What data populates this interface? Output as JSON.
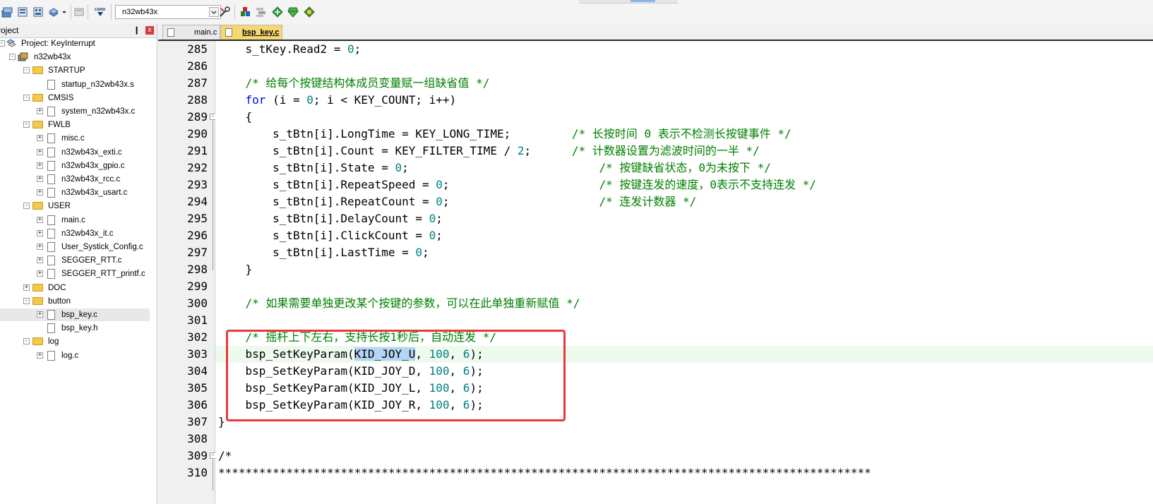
{
  "toolbar": {
    "target": "n32wb43x",
    "load_label": "LOAD",
    "icons": [
      "translate-icon",
      "rebuild-icon",
      "batch-build-icon",
      "stop-build-icon",
      "load-icon",
      "target-options-icon",
      "manage-components-icon",
      "select-pack-icon",
      "pack-installer-icon",
      "event-recorder-icon"
    ]
  },
  "project_panel": {
    "title": "roject",
    "pin": "❙",
    "close": "x",
    "tree": [
      {
        "label": "Project: KeyInterrupt",
        "type": "project",
        "level": 0,
        "expander": "-"
      },
      {
        "label": "n32wb43x",
        "type": "target",
        "level": 1,
        "expander": "-"
      },
      {
        "label": "STARTUP",
        "type": "folder",
        "level": 2,
        "expander": "-"
      },
      {
        "label": "startup_n32wb43x.s",
        "type": "file",
        "level": 3,
        "expander": ""
      },
      {
        "label": "CMSIS",
        "type": "folder",
        "level": 2,
        "expander": "-"
      },
      {
        "label": "system_n32wb43x.c",
        "type": "file",
        "level": 3,
        "expander": "+"
      },
      {
        "label": "FWLB",
        "type": "folder",
        "level": 2,
        "expander": "-"
      },
      {
        "label": "misc.c",
        "type": "file",
        "level": 3,
        "expander": "+"
      },
      {
        "label": "n32wb43x_exti.c",
        "type": "file",
        "level": 3,
        "expander": "+"
      },
      {
        "label": "n32wb43x_gpio.c",
        "type": "file",
        "level": 3,
        "expander": "+"
      },
      {
        "label": "n32wb43x_rcc.c",
        "type": "file",
        "level": 3,
        "expander": "+"
      },
      {
        "label": "n32wb43x_usart.c",
        "type": "file",
        "level": 3,
        "expander": "+"
      },
      {
        "label": "USER",
        "type": "folder",
        "level": 2,
        "expander": "-"
      },
      {
        "label": "main.c",
        "type": "file",
        "level": 3,
        "expander": "+"
      },
      {
        "label": "n32wb43x_it.c",
        "type": "file",
        "level": 3,
        "expander": "+"
      },
      {
        "label": "User_Systick_Config.c",
        "type": "file",
        "level": 3,
        "expander": "+"
      },
      {
        "label": "SEGGER_RTT.c",
        "type": "file",
        "level": 3,
        "expander": "+"
      },
      {
        "label": "SEGGER_RTT_printf.c",
        "type": "file",
        "level": 3,
        "expander": "+"
      },
      {
        "label": "DOC",
        "type": "folder",
        "level": 2,
        "expander": "+"
      },
      {
        "label": "button",
        "type": "folder",
        "level": 2,
        "expander": "-"
      },
      {
        "label": "bsp_key.c",
        "type": "file",
        "level": 3,
        "expander": "+",
        "selected": true
      },
      {
        "label": "bsp_key.h",
        "type": "file",
        "level": 3,
        "expander": ""
      },
      {
        "label": "log",
        "type": "folder",
        "level": 2,
        "expander": "-"
      },
      {
        "label": "log.c",
        "type": "file",
        "level": 3,
        "expander": "+"
      }
    ]
  },
  "editor": {
    "tabs": [
      {
        "label": "main.c",
        "active": false
      },
      {
        "label": "bsp_key.c",
        "active": true
      }
    ],
    "lines": [
      {
        "n": "285",
        "fold": "",
        "tokens": [
          [
            "t",
            "    s_tKey.Read2 = "
          ],
          [
            "num",
            "0"
          ],
          [
            "t",
            ";"
          ]
        ]
      },
      {
        "n": "286",
        "fold": "",
        "tokens": []
      },
      {
        "n": "287",
        "fold": "",
        "tokens": [
          [
            "t",
            "    "
          ],
          [
            "cm",
            "/* 给每个按键结构体成员变量赋一组缺省值 */"
          ]
        ]
      },
      {
        "n": "288",
        "fold": "",
        "tokens": [
          [
            "t",
            "    "
          ],
          [
            "kw",
            "for"
          ],
          [
            "t",
            " (i = "
          ],
          [
            "num",
            "0"
          ],
          [
            "t",
            "; i < KEY_COUNT; i++)"
          ]
        ]
      },
      {
        "n": "289",
        "fold": "-",
        "tokens": [
          [
            "t",
            "    {"
          ]
        ]
      },
      {
        "n": "290",
        "fold": "",
        "tokens": [
          [
            "t",
            "        s_tBtn[i].LongTime = KEY_LONG_TIME;         "
          ],
          [
            "cm",
            "/* 长按时间 0 表示不检测长按键事件 */"
          ]
        ]
      },
      {
        "n": "291",
        "fold": "",
        "tokens": [
          [
            "t",
            "        s_tBtn[i].Count = KEY_FILTER_TIME / "
          ],
          [
            "num",
            "2"
          ],
          [
            "t",
            ";      "
          ],
          [
            "cm",
            "/* 计数器设置为滤波时间的一半 */"
          ]
        ]
      },
      {
        "n": "292",
        "fold": "",
        "tokens": [
          [
            "t",
            "        s_tBtn[i].State = "
          ],
          [
            "num",
            "0"
          ],
          [
            "t",
            ";                            "
          ],
          [
            "cm",
            "/* 按键缺省状态，0为未按下 */"
          ]
        ]
      },
      {
        "n": "293",
        "fold": "",
        "tokens": [
          [
            "t",
            "        s_tBtn[i].RepeatSpeed = "
          ],
          [
            "num",
            "0"
          ],
          [
            "t",
            ";                      "
          ],
          [
            "cm",
            "/* 按键连发的速度，0表示不支持连发 */"
          ]
        ]
      },
      {
        "n": "294",
        "fold": "",
        "tokens": [
          [
            "t",
            "        s_tBtn[i].RepeatCount = "
          ],
          [
            "num",
            "0"
          ],
          [
            "t",
            ";                      "
          ],
          [
            "cm",
            "/* 连发计数器 */"
          ]
        ]
      },
      {
        "n": "295",
        "fold": "",
        "tokens": [
          [
            "t",
            "        s_tBtn[i].DelayCount = "
          ],
          [
            "num",
            "0"
          ],
          [
            "t",
            ";"
          ]
        ]
      },
      {
        "n": "296",
        "fold": "",
        "tokens": [
          [
            "t",
            "        s_tBtn[i].ClickCount = "
          ],
          [
            "num",
            "0"
          ],
          [
            "t",
            ";"
          ]
        ]
      },
      {
        "n": "297",
        "fold": "",
        "tokens": [
          [
            "t",
            "        s_tBtn[i].LastTime = "
          ],
          [
            "num",
            "0"
          ],
          [
            "t",
            ";"
          ]
        ]
      },
      {
        "n": "298",
        "fold": "",
        "tokens": [
          [
            "t",
            "    }"
          ]
        ]
      },
      {
        "n": "299",
        "fold": "",
        "tokens": []
      },
      {
        "n": "300",
        "fold": "",
        "tokens": [
          [
            "t",
            "    "
          ],
          [
            "cm",
            "/* 如果需要单独更改某个按键的参数，可以在此单独重新赋值 */"
          ]
        ]
      },
      {
        "n": "301",
        "fold": "",
        "tokens": []
      },
      {
        "n": "302",
        "fold": "",
        "tokens": [
          [
            "t",
            "    "
          ],
          [
            "cm",
            "/* 摇杆上下左右，支持长按1秒后，自动连发 */"
          ]
        ]
      },
      {
        "n": "303",
        "fold": "",
        "highlight": true,
        "tokens": [
          [
            "t",
            "    bsp_SetKeyParam("
          ],
          [
            "sel",
            "KID_JOY_U"
          ],
          [
            "t",
            ", "
          ],
          [
            "num",
            "100"
          ],
          [
            "t",
            ", "
          ],
          [
            "num",
            "6"
          ],
          [
            "t",
            ");"
          ]
        ]
      },
      {
        "n": "304",
        "fold": "",
        "tokens": [
          [
            "t",
            "    bsp_SetKeyParam(KID_JOY_D, "
          ],
          [
            "num",
            "100"
          ],
          [
            "t",
            ", "
          ],
          [
            "num",
            "6"
          ],
          [
            "t",
            ");"
          ]
        ]
      },
      {
        "n": "305",
        "fold": "",
        "tokens": [
          [
            "t",
            "    bsp_SetKeyParam(KID_JOY_L, "
          ],
          [
            "num",
            "100"
          ],
          [
            "t",
            ", "
          ],
          [
            "num",
            "6"
          ],
          [
            "t",
            ");"
          ]
        ]
      },
      {
        "n": "306",
        "fold": "",
        "tokens": [
          [
            "t",
            "    bsp_SetKeyParam(KID_JOY_R, "
          ],
          [
            "num",
            "100"
          ],
          [
            "t",
            ", "
          ],
          [
            "num",
            "6"
          ],
          [
            "t",
            ");"
          ]
        ]
      },
      {
        "n": "307",
        "fold": "",
        "tokens": [
          [
            "t",
            "}"
          ]
        ]
      },
      {
        "n": "308",
        "fold": "",
        "tokens": []
      },
      {
        "n": "309",
        "fold": "-",
        "tokens": [
          [
            "t",
            "/*"
          ]
        ]
      },
      {
        "n": "310",
        "fold": "",
        "tokens": [
          [
            "t",
            "************************************************************************************************"
          ]
        ]
      }
    ]
  },
  "annotation": {
    "color": "#e8383d"
  },
  "colors": {
    "keyword": "#0000ff",
    "number": "#008080",
    "comment": "#008000",
    "selection": "#b4d4f4",
    "tab_active": "#f6d772"
  }
}
